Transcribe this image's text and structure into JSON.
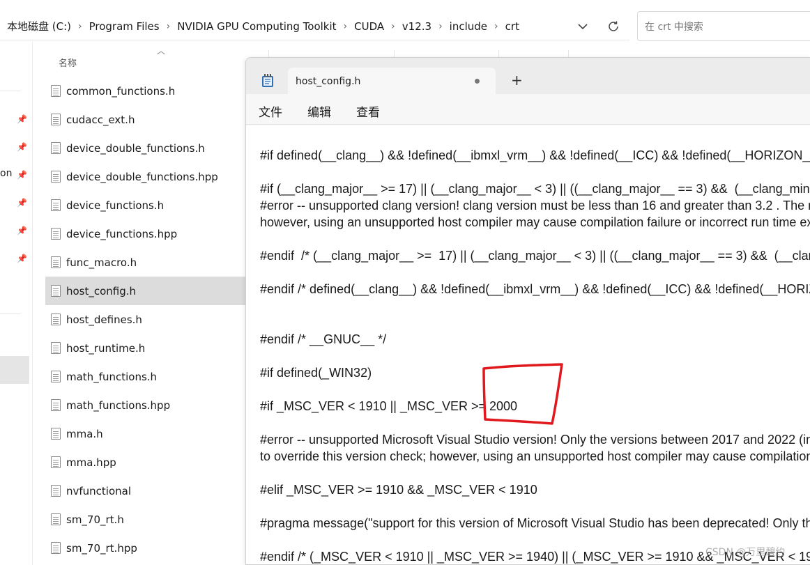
{
  "explorer": {
    "breadcrumb": [
      "本地磁盘 (C:)",
      "Program Files",
      "NVIDIA GPU Computing Toolkit",
      "CUDA",
      "v12.3",
      "include",
      "crt"
    ],
    "search_placeholder": "在 crt 中搜索",
    "nav_partial_text": "on",
    "column_header_name": "名称",
    "files": [
      {
        "name": "common_functions.h"
      },
      {
        "name": "cudacc_ext.h"
      },
      {
        "name": "device_double_functions.h"
      },
      {
        "name": "device_double_functions.hpp"
      },
      {
        "name": "device_functions.h"
      },
      {
        "name": "device_functions.hpp"
      },
      {
        "name": "func_macro.h"
      },
      {
        "name": "host_config.h",
        "selected": true
      },
      {
        "name": "host_defines.h"
      },
      {
        "name": "host_runtime.h"
      },
      {
        "name": "math_functions.h"
      },
      {
        "name": "math_functions.hpp"
      },
      {
        "name": "mma.h"
      },
      {
        "name": "mma.hpp"
      },
      {
        "name": "nvfunctional"
      },
      {
        "name": "sm_70_rt.h"
      },
      {
        "name": "sm_70_rt.hpp"
      }
    ]
  },
  "notepad": {
    "tab_title": "host_config.h",
    "new_tab": "+",
    "menu": {
      "file": "文件",
      "edit": "编辑",
      "view": "查看"
    },
    "code": "#if defined(__clang__) && !defined(__ibmxl_vrm__) && !defined(__ICC) && !defined(__HORIZON__)\n\n#if (__clang_major__ >= 17) || (__clang_major__ < 3) || ((__clang_major__ == 3) &&  (__clang_minor__ < 3))\n#error -- unsupported clang version! clang version must be less than 16 and greater than 3.2 . The nvcc flag '-allow-unsupported-compiler' can be used to override this version check;\nhowever, using an unsupported host compiler may cause compilation failure or incorrect run time execution. Use at your own risk.\n\n#endif  /* (__clang_major__ >=  17) || (__clang_major__ < 3) || ((__clang_major__ == 3) &&  (__clang_minor__ < 3)) */\n\n#endif /* defined(__clang__) && !defined(__ibmxl_vrm__) && !defined(__ICC) && !defined(__HORIZON__) */\n\n\n#endif /* __GNUC__ */\n\n#if defined(_WIN32)\n\n#if _MSC_VER < 1910 || _MSC_VER >= 2000\n\n#error -- unsupported Microsoft Visual Studio version! Only the versions between 2017 and 2022 (inclusive) are supported! The nvcc flag '-allow-unsupported-compiler' can be used\nto override this version check; however, using an unsupported host compiler may cause compilation failure or incorrect run time execution. Use at your own risk.\n\n#elif _MSC_VER >= 1910 && _MSC_VER < 1910\n\n#pragma message(\"support for this version of Microsoft Visual Studio has been deprecated! Only the versions between 2017 and 2022 (inclusive) are supported!\")\n\n#endif /* (_MSC_VER < 1910 || _MSC_VER >= 1940) || (_MSC_VER >= 1910 && _MSC_VER < 1910) */"
  },
  "annotation_color": "#e0191e",
  "watermark": "CSDN @万里碧约"
}
